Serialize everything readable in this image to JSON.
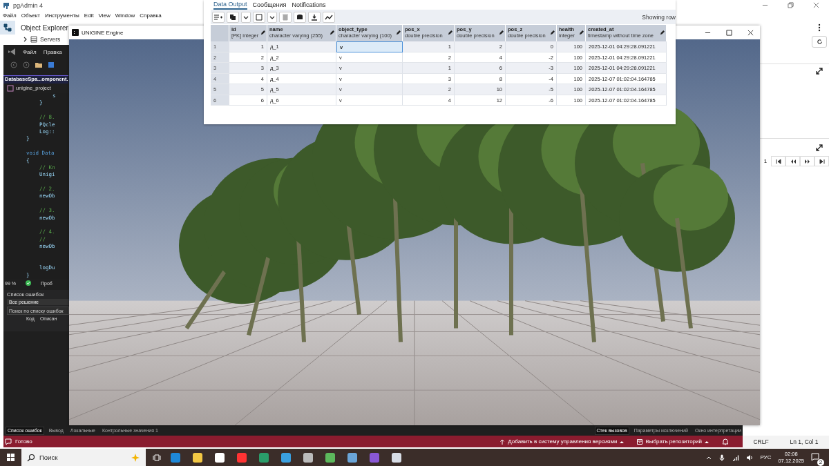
{
  "pgadmin": {
    "title": "pgAdmin 4",
    "menu": [
      "Файл",
      "Объект",
      "Инструменты",
      "Edit",
      "View",
      "Window",
      "Справка"
    ],
    "object_explorer": {
      "title": "Object Explorer",
      "items": [
        "Servers"
      ]
    },
    "pagination": {
      "page": "1"
    },
    "status": {
      "line_ending": "CRLF",
      "position": "Ln 1, Col 1"
    }
  },
  "visual_studio": {
    "menu": [
      "Файл",
      "Правка"
    ],
    "document_tab": "DatabaseSpa...omponent.",
    "project": "unigine_project",
    "code": [
      {
        "kind": "block",
        "children": [
          {
            "kind": "block",
            "children": [
              {
                "kind": "code",
                "text": "s"
              }
            ]
          },
          {
            "kind": "code",
            "text": "}"
          },
          {
            "kind": "blank"
          },
          {
            "kind": "comment",
            "text": "// 8."
          },
          {
            "kind": "code",
            "text": "PQcle"
          },
          {
            "kind": "code",
            "text": "Log::"
          }
        ]
      },
      {
        "kind": "code",
        "text": "}"
      },
      {
        "kind": "blank"
      },
      {
        "kind": "decl",
        "text": "void Data"
      },
      {
        "kind": "code",
        "text": "{"
      },
      {
        "kind": "block",
        "children": [
          {
            "kind": "comment",
            "text": "// Кл"
          },
          {
            "kind": "code",
            "text": "Unigi"
          },
          {
            "kind": "blank"
          },
          {
            "kind": "comment",
            "text": "// 2."
          },
          {
            "kind": "code",
            "text": "newOb"
          },
          {
            "kind": "blank"
          },
          {
            "kind": "comment",
            "text": "// 3."
          },
          {
            "kind": "code",
            "text": "newOb"
          },
          {
            "kind": "blank"
          },
          {
            "kind": "comment",
            "text": "// 4."
          },
          {
            "kind": "comment",
            "text": "//"
          },
          {
            "kind": "code",
            "text": "newOb"
          },
          {
            "kind": "blank"
          },
          {
            "kind": "blank"
          },
          {
            "kind": "code",
            "text": "logDu"
          }
        ]
      },
      {
        "kind": "code",
        "text": "}"
      }
    ],
    "zoom": "99 %",
    "issues": "Проб",
    "error_list": {
      "title": "Список ошибок",
      "scope": "Все решение",
      "search_placeholder": "Поиск по списку ошибок",
      "columns": [
        "Код",
        "Описан"
      ]
    },
    "bottom_tabs": [
      {
        "label": "Список ошибок",
        "selected": true
      },
      {
        "label": "Вывод",
        "selected": false
      },
      {
        "label": "Локальные",
        "selected": false
      },
      {
        "label": "Контрольные значения 1",
        "selected": false
      }
    ],
    "debug_tabs": [
      {
        "label": "Стек вызовов",
        "selected": true
      },
      {
        "label": "Параметры исключений",
        "selected": false
      },
      {
        "label": "Окно интерпретации",
        "selected": false
      }
    ],
    "status": {
      "text": "Готово",
      "source_control": "Добавить в систему управления версиями",
      "repository": "Выбрать репозиторий"
    }
  },
  "unigine": {
    "title": "UNIGINE Engine"
  },
  "data_output": {
    "tabs": [
      {
        "label": "Data Output",
        "selected": true
      },
      {
        "label": "Сообщения",
        "selected": false
      },
      {
        "label": "Notifications",
        "selected": false
      }
    ],
    "showing": "Showing row",
    "columns": [
      {
        "name": "id",
        "type": "[PK] integer",
        "kind": "number"
      },
      {
        "name": "name",
        "type": "character varying (255)",
        "kind": "text"
      },
      {
        "name": "object_type",
        "type": "character varying (100)",
        "kind": "text"
      },
      {
        "name": "pos_x",
        "type": "double precision",
        "kind": "number"
      },
      {
        "name": "pos_y",
        "type": "double precision",
        "kind": "number"
      },
      {
        "name": "pos_z",
        "type": "double precision",
        "kind": "number"
      },
      {
        "name": "health",
        "type": "integer",
        "kind": "number"
      },
      {
        "name": "created_at",
        "type": "timestamp without time zone",
        "kind": "text"
      }
    ],
    "rows": [
      {
        "number": "1",
        "cells": [
          {
            "value": "1",
            "selected": false
          },
          {
            "value": "д_1",
            "selected": false
          },
          {
            "value": "v",
            "selected": true
          },
          {
            "value": "1",
            "selected": false
          },
          {
            "value": "2",
            "selected": false
          },
          {
            "value": "0",
            "selected": false
          },
          {
            "value": "100",
            "selected": false
          },
          {
            "value": "2025-12-01 04:29:28.091221",
            "selected": false
          }
        ]
      },
      {
        "number": "2",
        "cells": [
          {
            "value": "2",
            "selected": false
          },
          {
            "value": "д_2",
            "selected": false
          },
          {
            "value": "v",
            "selected": false
          },
          {
            "value": "2",
            "selected": false
          },
          {
            "value": "4",
            "selected": false
          },
          {
            "value": "-2",
            "selected": false
          },
          {
            "value": "100",
            "selected": false
          },
          {
            "value": "2025-12-01 04:29:28.091221",
            "selected": false
          }
        ]
      },
      {
        "number": "3",
        "cells": [
          {
            "value": "3",
            "selected": false
          },
          {
            "value": "д_3",
            "selected": false
          },
          {
            "value": "v",
            "selected": false
          },
          {
            "value": "1",
            "selected": false
          },
          {
            "value": "6",
            "selected": false
          },
          {
            "value": "-3",
            "selected": false
          },
          {
            "value": "100",
            "selected": false
          },
          {
            "value": "2025-12-01 04:29:28.091221",
            "selected": false
          }
        ]
      },
      {
        "number": "4",
        "cells": [
          {
            "value": "4",
            "selected": false
          },
          {
            "value": "д_4",
            "selected": false
          },
          {
            "value": "v",
            "selected": false
          },
          {
            "value": "3",
            "selected": false
          },
          {
            "value": "8",
            "selected": false
          },
          {
            "value": "-4",
            "selected": false
          },
          {
            "value": "100",
            "selected": false
          },
          {
            "value": "2025-12-07 01:02:04.164785",
            "selected": false
          }
        ]
      },
      {
        "number": "5",
        "cells": [
          {
            "value": "5",
            "selected": false
          },
          {
            "value": "д_5",
            "selected": false
          },
          {
            "value": "v",
            "selected": false
          },
          {
            "value": "2",
            "selected": false
          },
          {
            "value": "10",
            "selected": false
          },
          {
            "value": "-5",
            "selected": false
          },
          {
            "value": "100",
            "selected": false
          },
          {
            "value": "2025-12-07 01:02:04.164785",
            "selected": false
          }
        ]
      },
      {
        "number": "6",
        "cells": [
          {
            "value": "6",
            "selected": false
          },
          {
            "value": "д_6",
            "selected": false
          },
          {
            "value": "v",
            "selected": false
          },
          {
            "value": "4",
            "selected": false
          },
          {
            "value": "12",
            "selected": false
          },
          {
            "value": "-6",
            "selected": false
          },
          {
            "value": "100",
            "selected": false
          },
          {
            "value": "2025-12-07 01:02:04.164785",
            "selected": false
          }
        ]
      }
    ]
  },
  "taskbar": {
    "search_placeholder": "Поиск",
    "language": "РУС",
    "time": "02:08",
    "date": "07.12.2025",
    "notifications": "2"
  }
}
